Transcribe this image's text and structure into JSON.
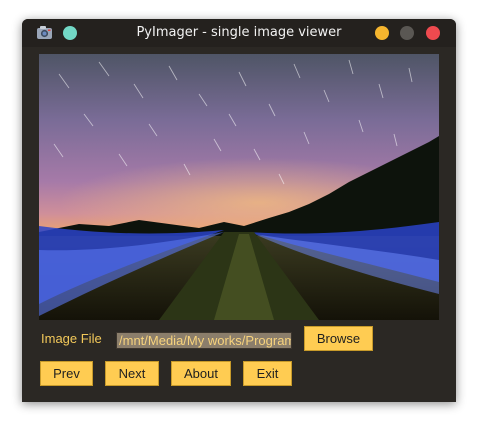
{
  "window": {
    "title": "PyImager - single image viewer",
    "app_icon": "app-icon",
    "controls": [
      "minimize-icon",
      "maximize-icon",
      "close-icon"
    ]
  },
  "image": {
    "description_icon": "photo-viewer-image"
  },
  "form": {
    "image_file_label": "Image File",
    "image_path_value": "/mnt/Media/My works/Program",
    "browse_label": "Browse"
  },
  "nav": {
    "prev_label": "Prev",
    "next_label": "Next",
    "about_label": "About",
    "exit_label": "Exit"
  },
  "colors": {
    "accent": "#ffcc52",
    "label": "#f3c95a",
    "window_bg": "#2b2824"
  }
}
